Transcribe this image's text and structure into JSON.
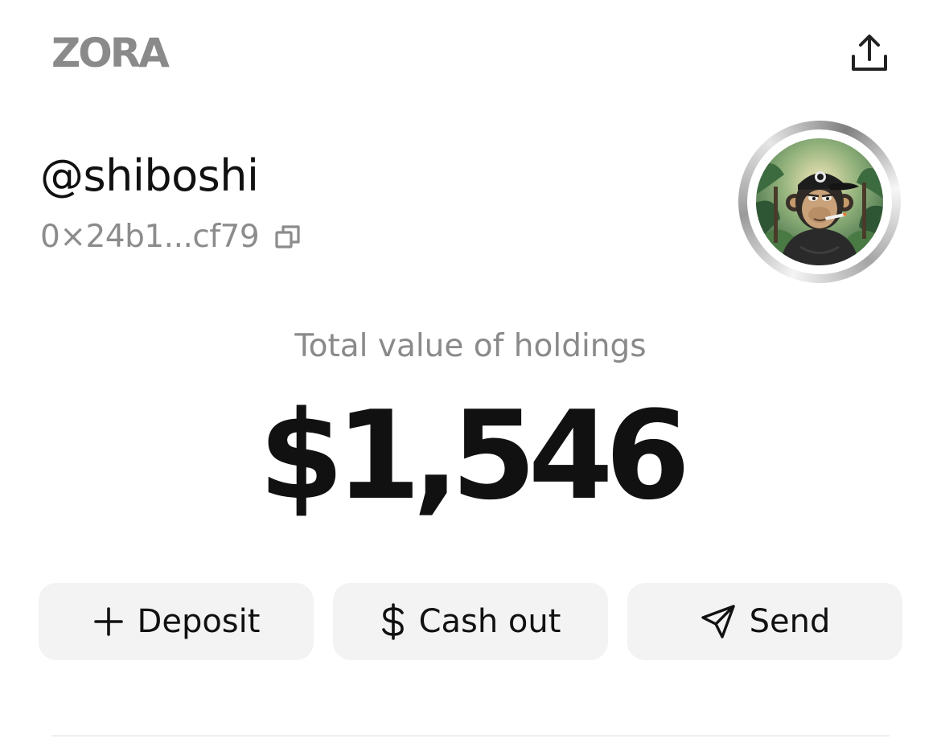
{
  "header": {
    "logo_text": "ZORA",
    "share_icon": "share-upload-icon"
  },
  "profile": {
    "username": "@shiboshi",
    "address": "0×24b1...cf79",
    "copy_icon": "copy-icon",
    "avatar_description": "avatar"
  },
  "holdings": {
    "label": "Total value of holdings",
    "value": "$1,546"
  },
  "actions": [
    {
      "label": "Deposit",
      "icon": "plus-icon"
    },
    {
      "label": "Cash out",
      "icon": "dollar-icon"
    },
    {
      "label": "Send",
      "icon": "paper-plane-icon"
    }
  ],
  "colors": {
    "background": "#ffffff",
    "text_primary": "#111111",
    "text_secondary": "#8a8a8a",
    "button_bg": "#f3f3f3"
  }
}
